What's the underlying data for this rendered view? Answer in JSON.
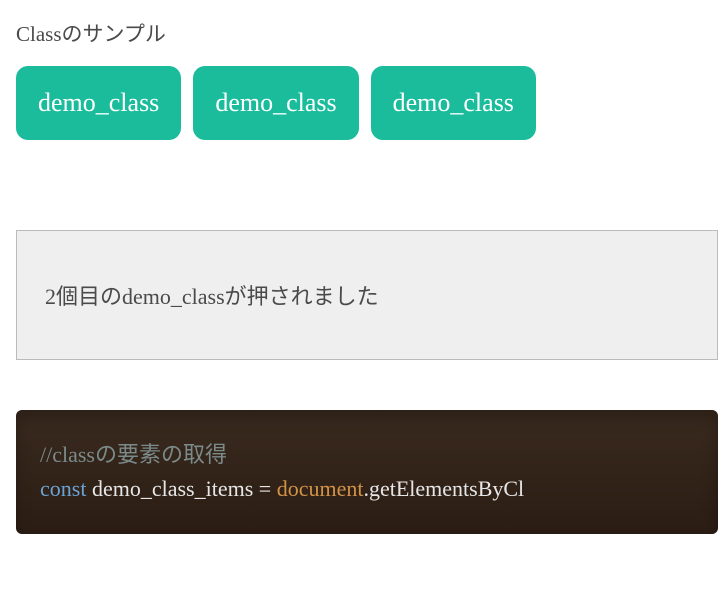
{
  "section": {
    "title": "Classのサンプル"
  },
  "buttons": {
    "b1": "demo_class",
    "b2": "demo_class",
    "b3": "demo_class"
  },
  "output": {
    "message": "2個目のdemo_classが押されました"
  },
  "code": {
    "comment": "//classの要素の取得",
    "keyword": "const ",
    "var": "demo_class_items ",
    "equals": "= ",
    "builtin": "document",
    "call": ".getElementsByCl"
  }
}
